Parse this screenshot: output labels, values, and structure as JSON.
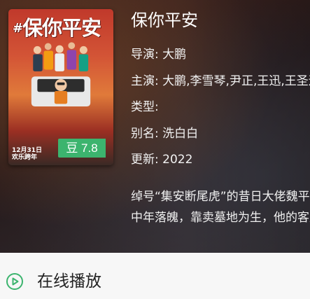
{
  "poster": {
    "title": "保你平安",
    "hashtag": "#",
    "date_line1": "12月31日",
    "date_line2": "欢乐跨年"
  },
  "score": {
    "label": "豆",
    "value": "7.8"
  },
  "movie": {
    "title": "保你平安",
    "director_key": "导演",
    "director": "大鹏",
    "cast_key": "主演",
    "cast": "大鹏,李雪琴,尹正,王迅,王圣迪",
    "genre_key": "类型",
    "genre": "",
    "alias_key": "别名",
    "alias": "洗白白",
    "updated_key": "更新",
    "updated": "2022"
  },
  "description": {
    "line1": "绰号“集安断尾虎”的昔日大佬魏平安",
    "line2": "中年落魄，靠卖墓地为生，他的客户"
  },
  "actions": {
    "online_play": "在线播放"
  },
  "colors": {
    "score_badge": "#3cb46e",
    "play_icon": "#3cb46e"
  },
  "icons": {
    "play": "play-circle-icon"
  }
}
